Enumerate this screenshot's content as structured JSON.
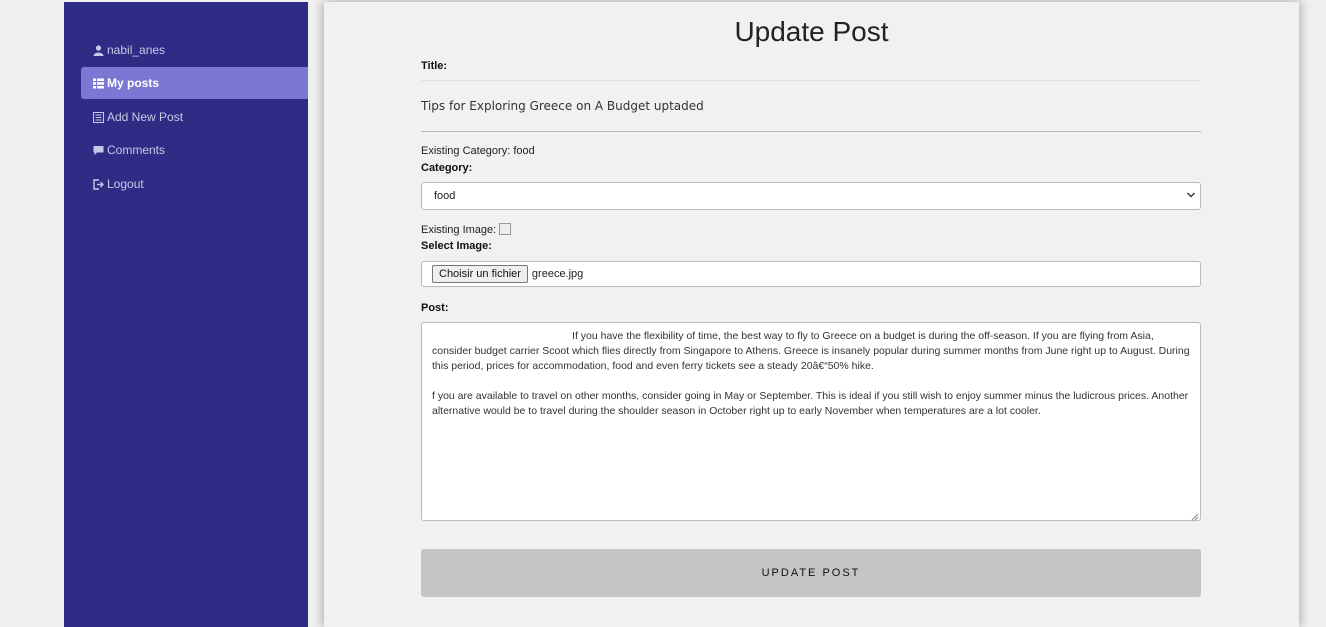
{
  "sidebar": {
    "items": [
      {
        "label": "nabil_anes",
        "icon": "user-icon",
        "active": false
      },
      {
        "label": "My posts",
        "icon": "list-icon",
        "active": true
      },
      {
        "label": "Add New Post",
        "icon": "document-icon",
        "active": false
      },
      {
        "label": "Comments",
        "icon": "comment-icon",
        "active": false
      },
      {
        "label": "Logout",
        "icon": "logout-icon",
        "active": false
      }
    ]
  },
  "form": {
    "heading": "Update Post",
    "title_label": "Title:",
    "title_value": "Tips for Exploring Greece on A Budget uptaded",
    "existing_category": "Existing Category: food",
    "category_label": "Category:",
    "category_selected": "food",
    "existing_image": "Existing Image:",
    "image_label": "Select Image:",
    "file_button": "Choisir un fichier",
    "file_name": "greece.jpg",
    "post_label": "Post:",
    "post_para1": "                                                If you have the flexibility of time, the best way to fly to Greece on a budget is during the off-season. If you are flying from Asia, consider budget carrier Scoot which flies directly from Singapore to Athens. Greece is insanely popular during summer months from June right up to August. During this period, prices for accommodation, food and even ferry tickets see a steady 20â€“50% hike.",
    "post_para2": "f you are available to travel on other months, consider going in May or September. This is ideal if you still wish to enjoy summer minus the ludicrous prices. Another alternative would be to travel during the shoulder season in October right up to early November when temperatures are a lot cooler.",
    "submit_label": "UPDATE POST"
  },
  "colors": {
    "sidebar_bg": "#2e2c85",
    "sidebar_active": "#7b78d4",
    "button_bg": "#c4c4c4"
  }
}
